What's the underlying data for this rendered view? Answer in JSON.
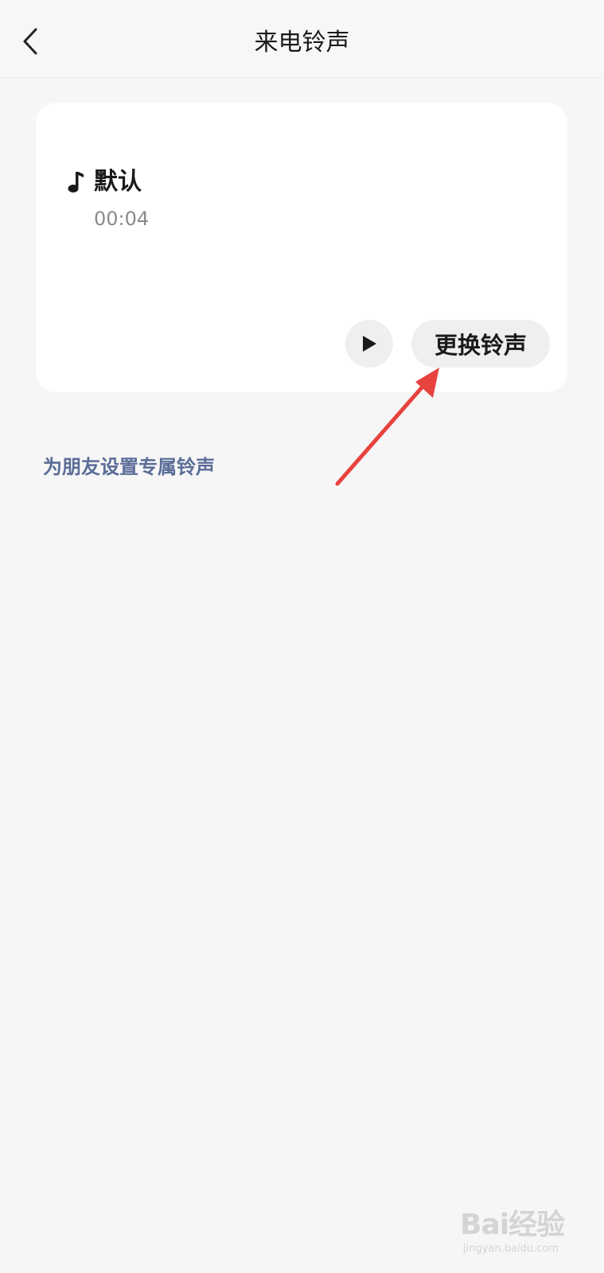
{
  "header": {
    "title": "来电铃声"
  },
  "ringtone": {
    "name": "默认",
    "duration": "00:04",
    "change_label": "更换铃声"
  },
  "friend_link": "为朋友设置专属铃声",
  "watermark": {
    "logo": "Bai经验",
    "sub": "jingyan.baidu.com"
  },
  "colors": {
    "background": "#f6f6f6",
    "card": "#ffffff",
    "link": "#5a6c97",
    "annotation_arrow": "#e8423e"
  },
  "icons": {
    "back": "chevron-left-icon",
    "note": "music-note-icon",
    "play": "play-icon"
  }
}
